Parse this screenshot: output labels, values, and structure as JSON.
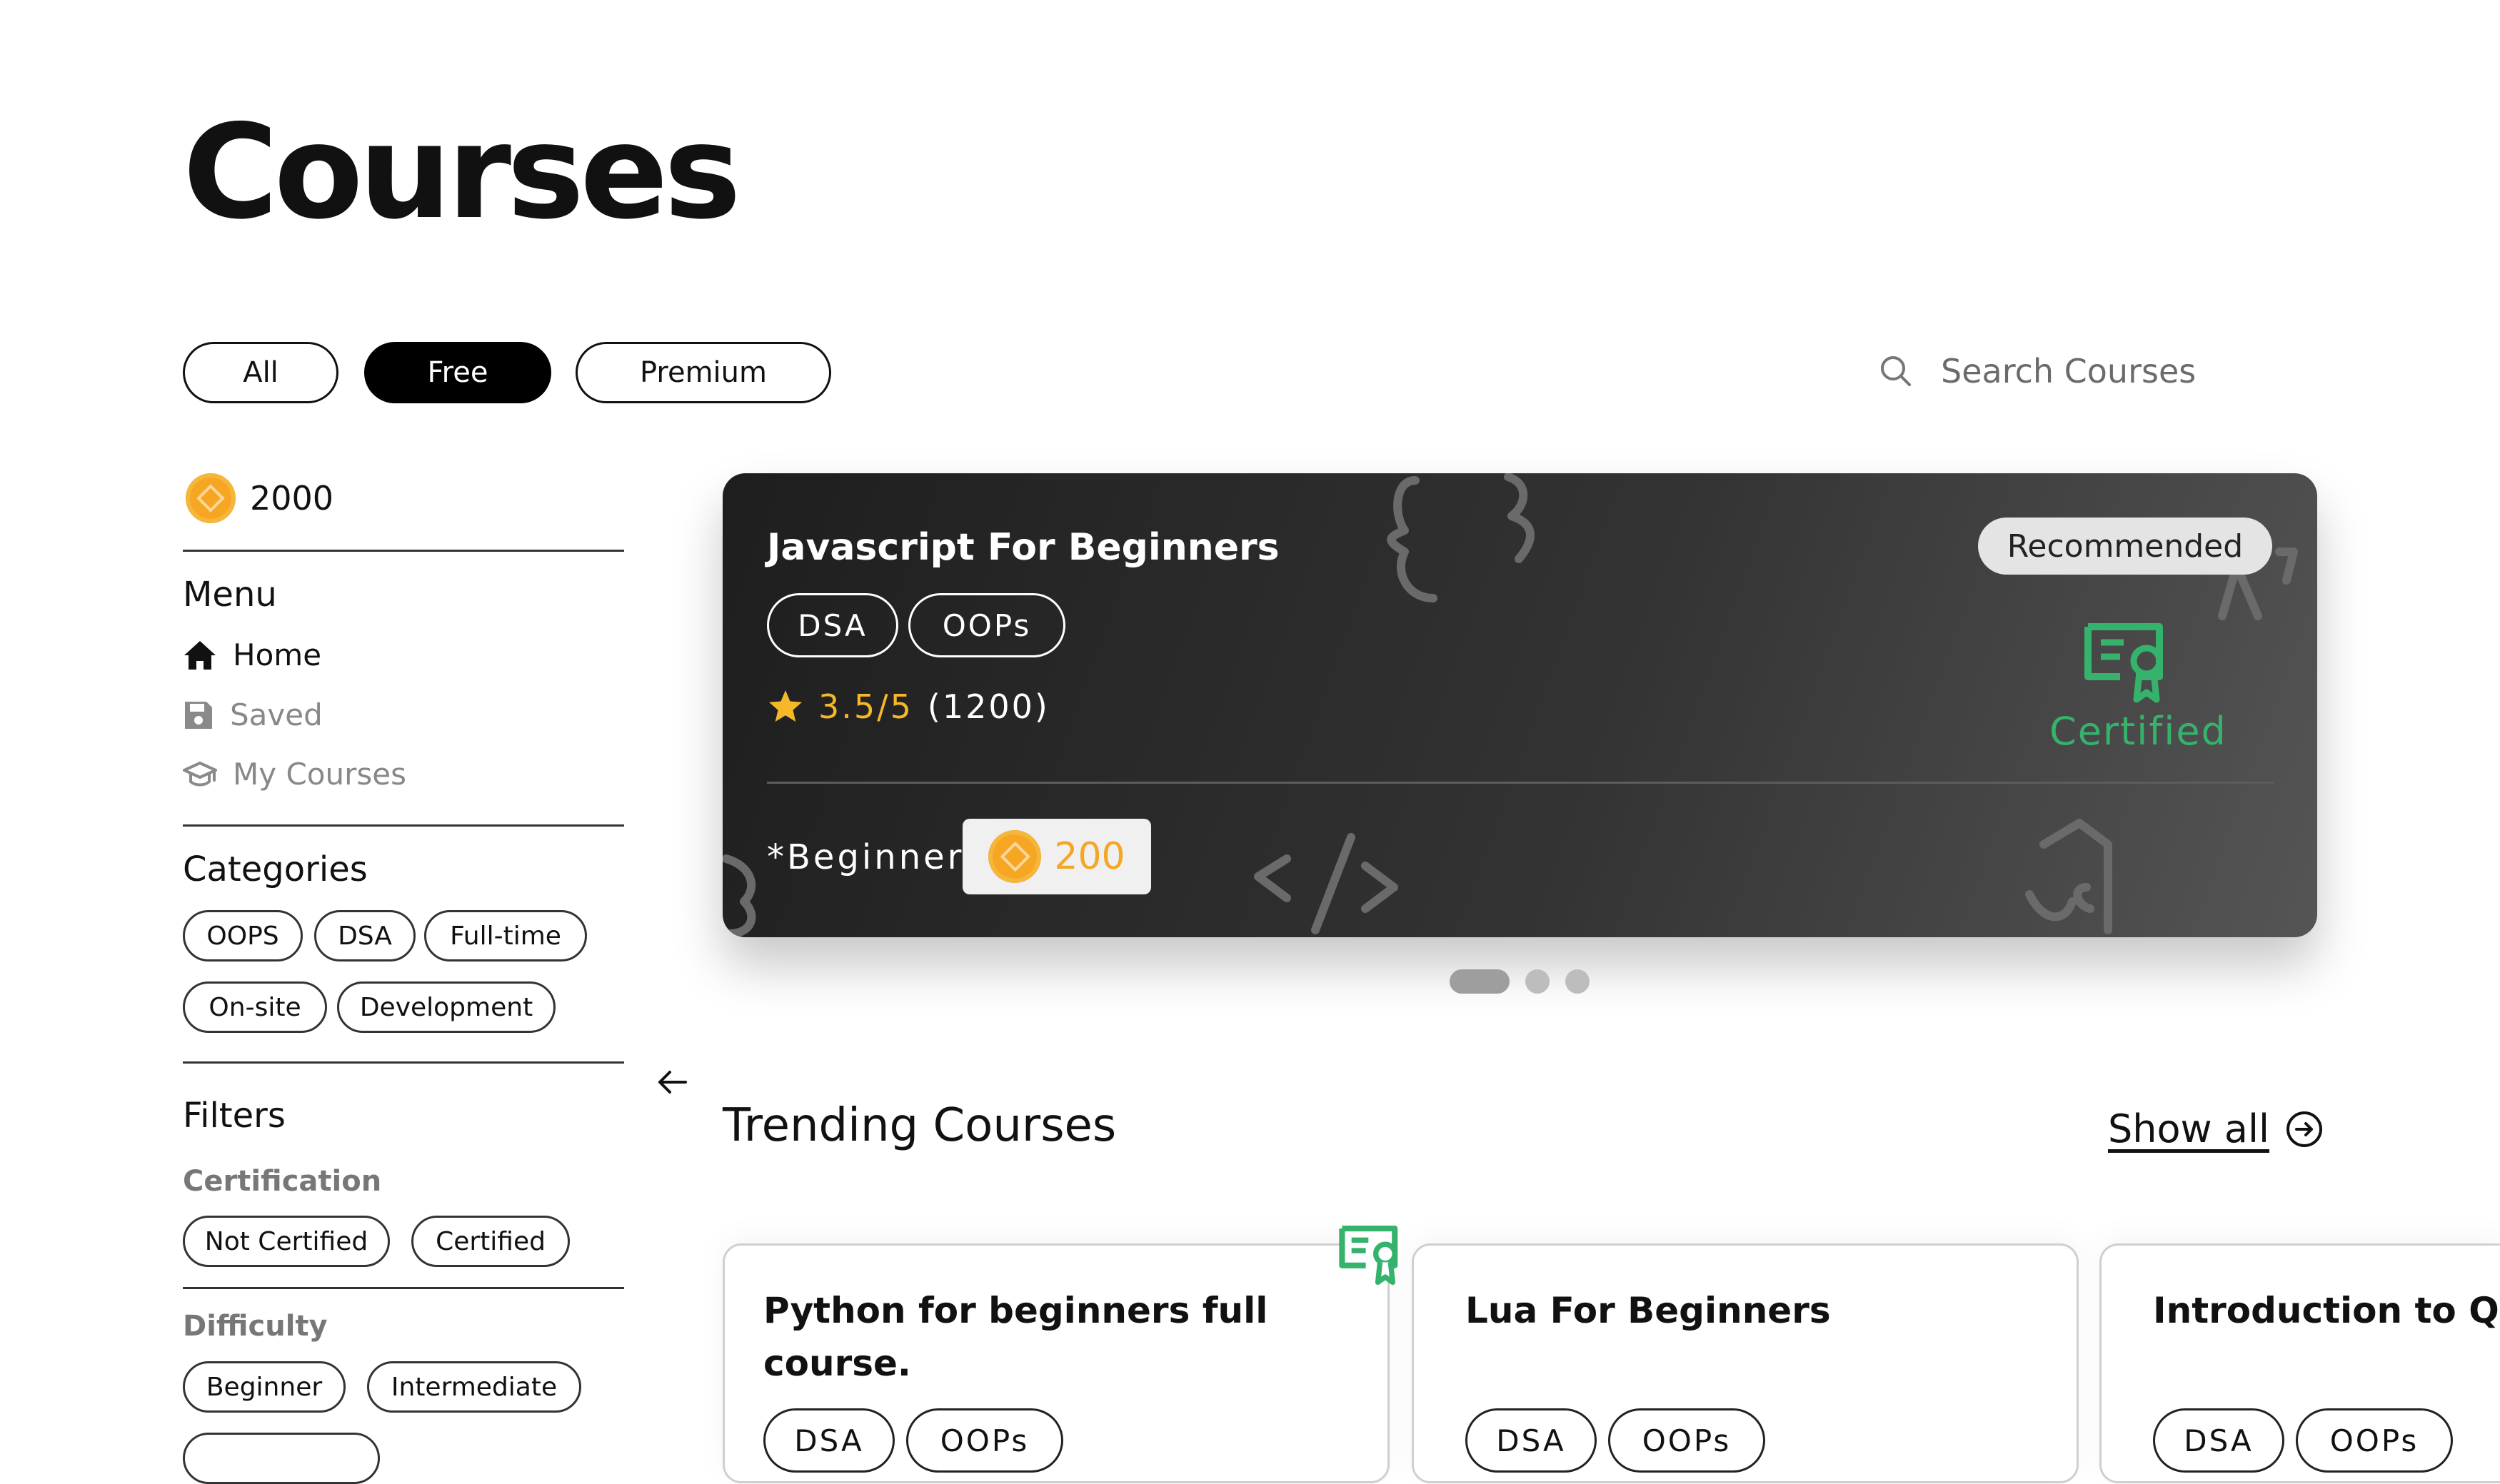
{
  "page_title": "Courses",
  "tabs": [
    {
      "label": "All",
      "active": false
    },
    {
      "label": "Free",
      "active": true
    },
    {
      "label": "Premium",
      "active": false
    }
  ],
  "search": {
    "placeholder": "Search Courses"
  },
  "coins": {
    "balance": "2000"
  },
  "menu": {
    "heading": "Menu",
    "items": [
      {
        "label": "Home",
        "icon": "home-icon",
        "active": true
      },
      {
        "label": "Saved",
        "icon": "save-icon",
        "active": false
      },
      {
        "label": "My Courses",
        "icon": "graduation-cap-icon",
        "active": false
      }
    ]
  },
  "categories": {
    "heading": "Categories",
    "items": [
      "OOPS",
      "DSA",
      "Full-time",
      "On-site",
      "Development"
    ]
  },
  "filters": {
    "heading": "Filters",
    "certification": {
      "label": "Certification",
      "options": [
        "Not Certified",
        "Certified"
      ]
    },
    "difficulty": {
      "label": "Difficulty",
      "options": [
        "Beginner",
        "Intermediate"
      ]
    }
  },
  "featured": {
    "title": "Javascript For Beginners",
    "tags": [
      "DSA",
      "OOPs"
    ],
    "rating": "3.5/5",
    "rating_count": "(1200)",
    "badge": "Recommended",
    "certified_label": "Certified",
    "level": "*Beginner",
    "price": "200",
    "carousel": {
      "count": 3,
      "active": 0
    }
  },
  "trending": {
    "heading": "Trending Courses",
    "show_all": "Show all",
    "courses": [
      {
        "title": "Python for beginners full course.",
        "tags": [
          "DSA",
          "OOPs"
        ],
        "certified": true
      },
      {
        "title": "Lua For Beginners",
        "tags": [
          "DSA",
          "OOPs"
        ],
        "certified": false
      },
      {
        "title": "Introduction to QBasic",
        "tags": [
          "DSA",
          "OOPs"
        ],
        "certified": false
      }
    ]
  },
  "colors": {
    "accent_green": "#35b36c",
    "coin_orange": "#f6a623",
    "rating_gold": "#f5b829"
  }
}
